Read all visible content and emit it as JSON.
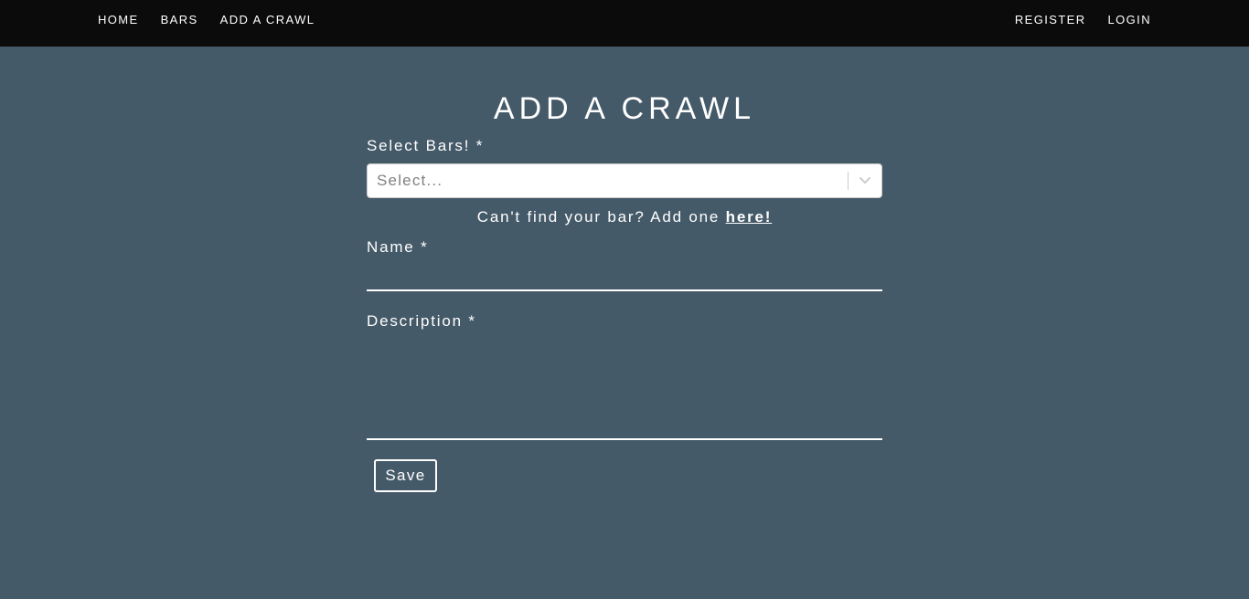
{
  "nav": {
    "left": [
      {
        "label": "HOME"
      },
      {
        "label": "BARS"
      },
      {
        "label": "ADD A CRAWL"
      }
    ],
    "right": [
      {
        "label": "REGISTER"
      },
      {
        "label": "LOGIN"
      }
    ]
  },
  "page": {
    "title": "ADD A CRAWL"
  },
  "form": {
    "bars_label": "Select Bars! *",
    "bars_placeholder": "Select...",
    "bars_icon": "chevron-down-icon",
    "helper_text": "Can't find your bar? Add one ",
    "helper_link": "here!",
    "name_label": "Name *",
    "name_value": "",
    "description_label": "Description *",
    "description_value": "",
    "save_label": "Save"
  },
  "colors": {
    "background": "#455a69",
    "navbar": "#0b0b0b",
    "text": "#ffffff"
  }
}
